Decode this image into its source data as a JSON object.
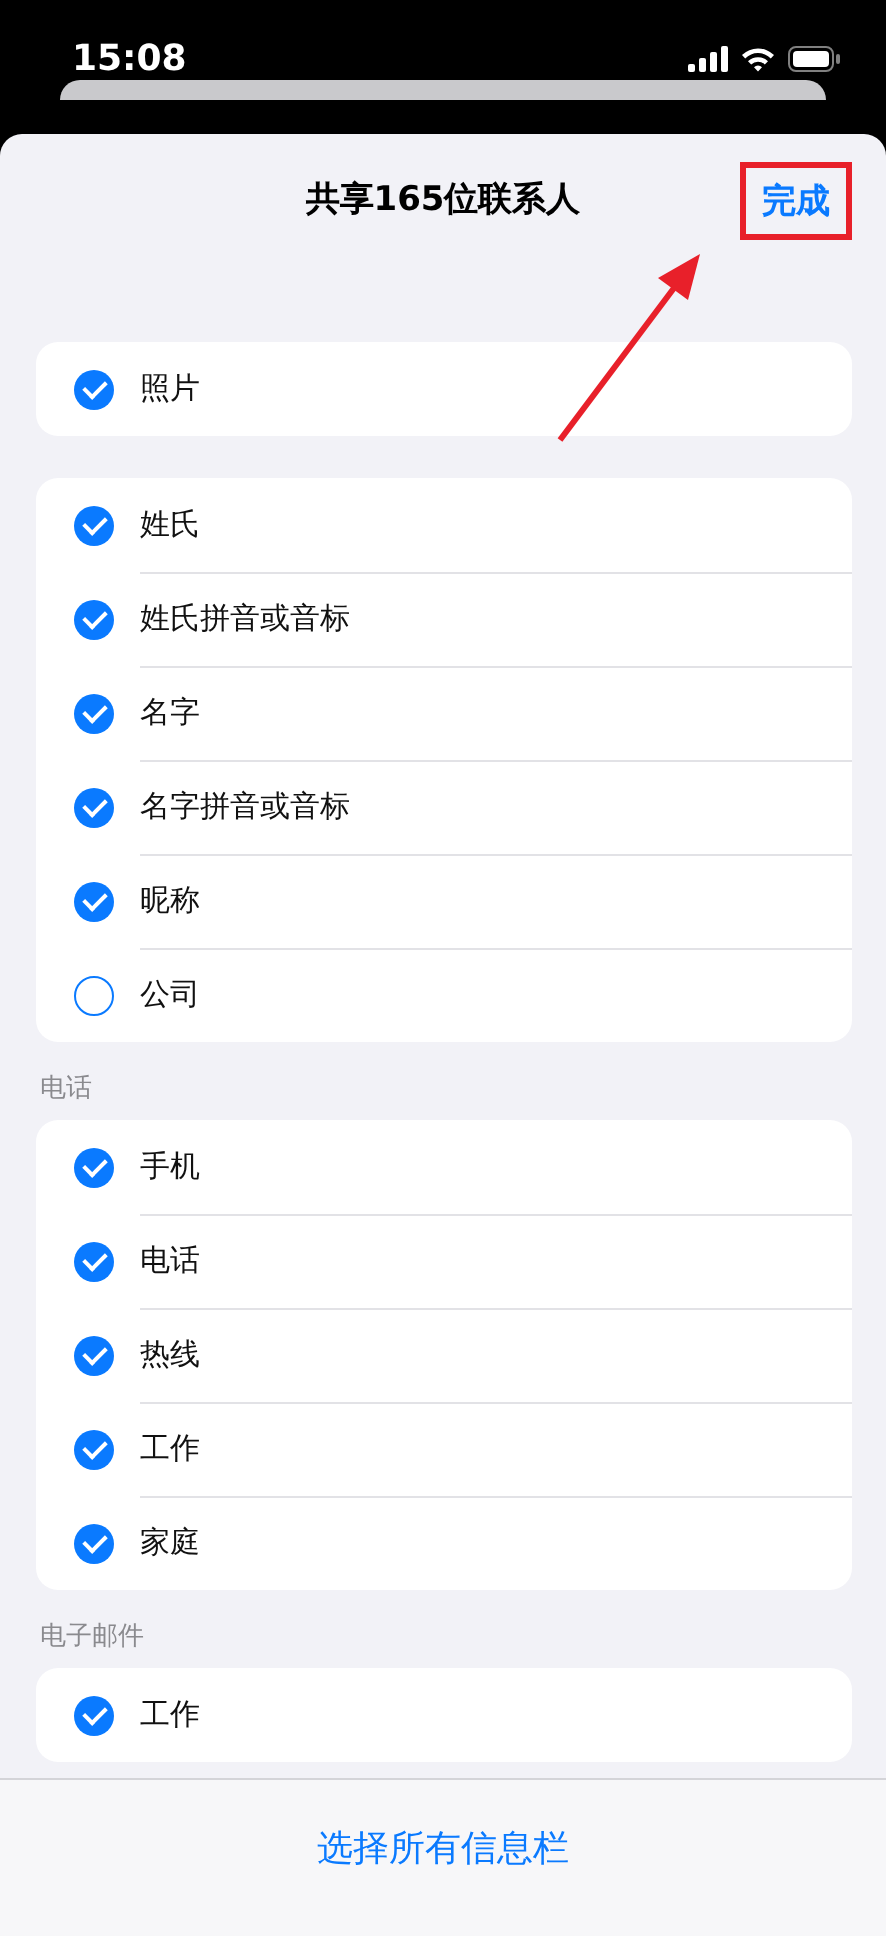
{
  "status_bar": {
    "time": "15:08"
  },
  "header": {
    "title": "共享165位联系人",
    "done": "完成"
  },
  "groups": [
    {
      "rows": [
        {
          "label": "照片",
          "checked": true
        }
      ]
    },
    {
      "rows": [
        {
          "label": "姓氏",
          "checked": true
        },
        {
          "label": "姓氏拼音或音标",
          "checked": true
        },
        {
          "label": "名字",
          "checked": true
        },
        {
          "label": "名字拼音或音标",
          "checked": true
        },
        {
          "label": "昵称",
          "checked": true
        },
        {
          "label": "公司",
          "checked": false
        }
      ]
    },
    {
      "header": "电话",
      "rows": [
        {
          "label": "手机",
          "checked": true
        },
        {
          "label": "电话",
          "checked": true
        },
        {
          "label": "热线",
          "checked": true
        },
        {
          "label": "工作",
          "checked": true
        },
        {
          "label": "家庭",
          "checked": true
        }
      ]
    },
    {
      "header": "电子邮件",
      "rows": [
        {
          "label": "工作",
          "checked": true
        }
      ]
    }
  ],
  "bottom_button": "选择所有信息栏"
}
